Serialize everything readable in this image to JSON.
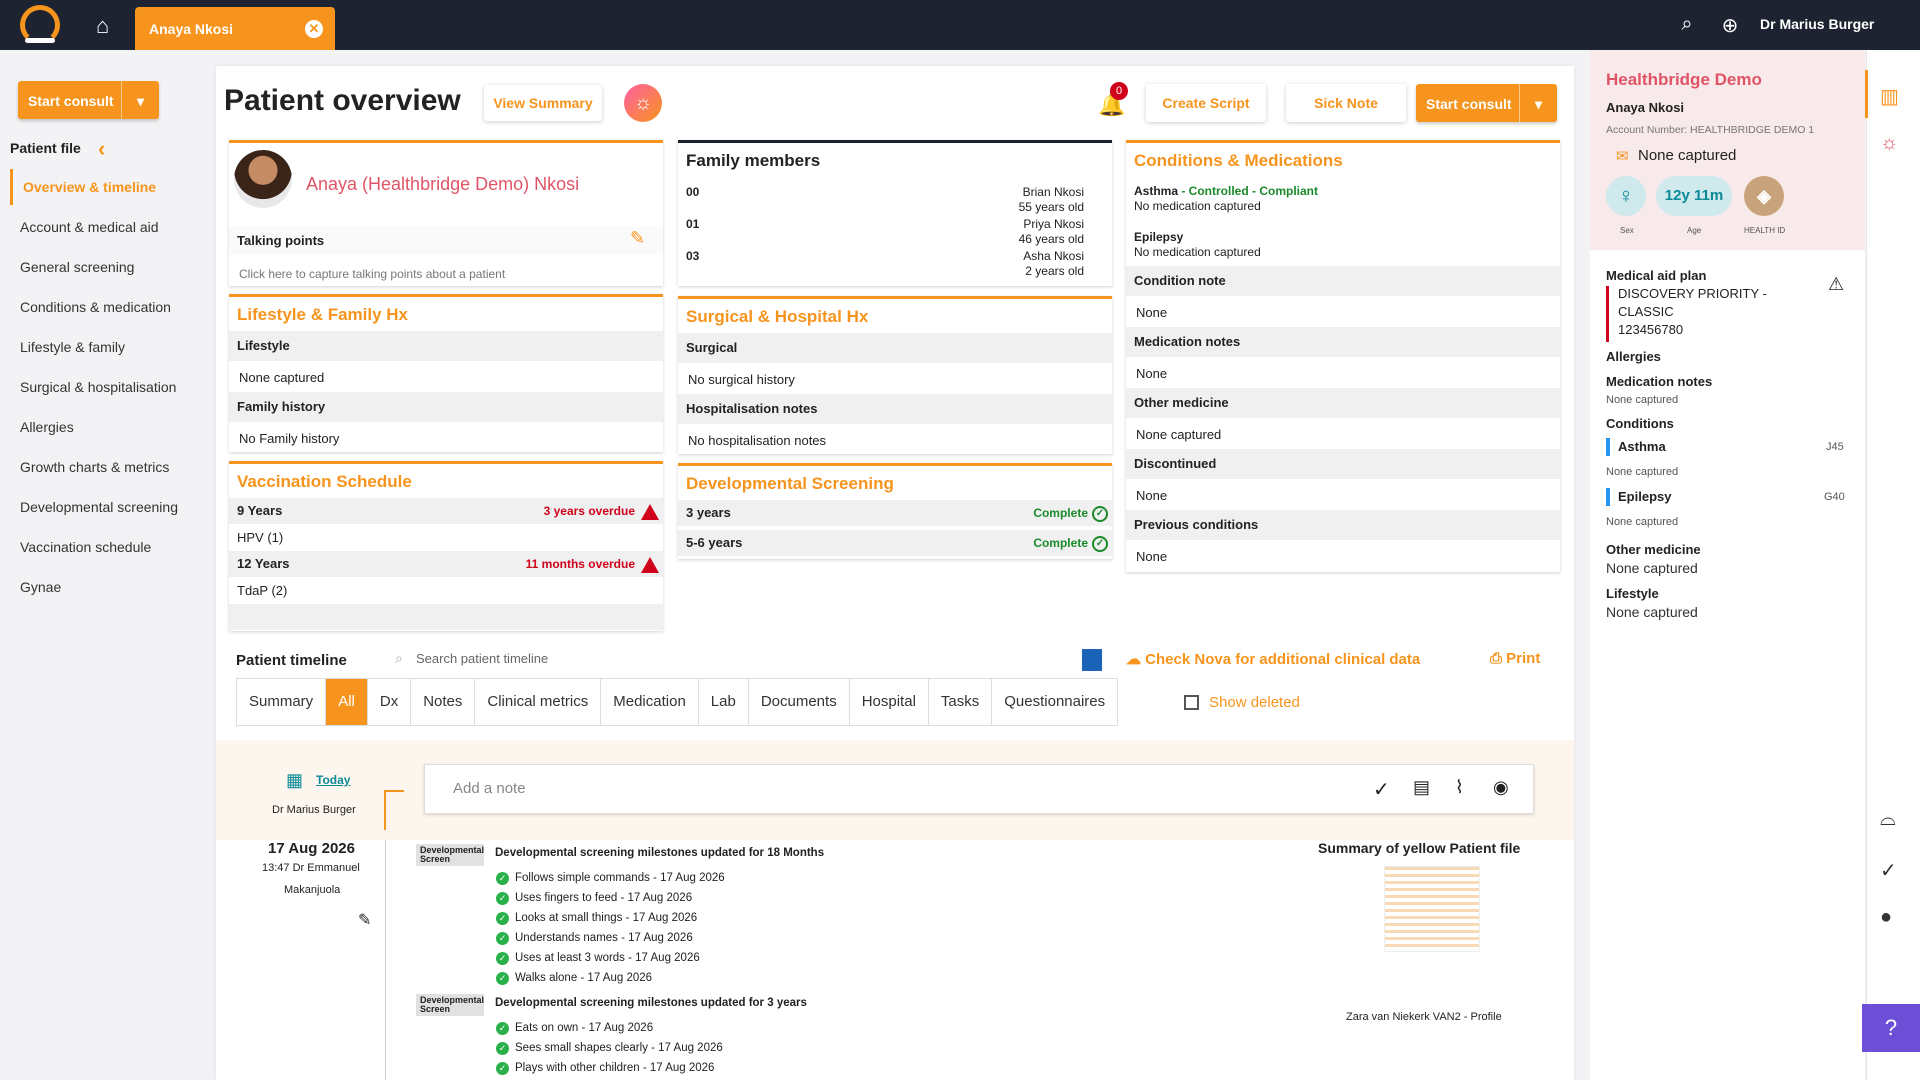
{
  "topbar": {
    "tab_name": "Anaya Nkosi",
    "user": "Dr Marius Burger"
  },
  "sidebar": {
    "start_consult": "Start consult",
    "title": "Patient file",
    "items": [
      "Overview & timeline",
      "Account & medical aid",
      "General screening",
      "Conditions & medication",
      "Lifestyle & family",
      "Surgical & hospitalisation",
      "Allergies",
      "Growth charts & metrics",
      "Developmental screening",
      "Vaccination schedule",
      "Gynae"
    ]
  },
  "header": {
    "title": "Patient overview",
    "view_summary": "View Summary",
    "notif_count": "0",
    "create_script": "Create Script",
    "sick_note": "Sick Note",
    "start_consult": "Start consult"
  },
  "patient": {
    "name": "Anaya (Healthbridge Demo) Nkosi",
    "talking_points": "Talking points",
    "talking_placeholder": "Click here to capture talking points about a patient"
  },
  "family": {
    "title": "Family members",
    "members": [
      {
        "code": "00",
        "name": "Brian Nkosi",
        "age": "55 years old"
      },
      {
        "code": "01",
        "name": "Priya Nkosi",
        "age": "46 years old"
      },
      {
        "code": "03",
        "name": "Asha Nkosi",
        "age": "2 years old"
      }
    ]
  },
  "conditions": {
    "title": "Conditions & Medications",
    "c1_name": "Asthma",
    "c1_status": " - Controlled - Compliant",
    "c1_med": "No medication captured",
    "c2_name": "Epilepsy",
    "c2_med": "No medication captured",
    "rows": [
      {
        "h": "Condition note",
        "v": "None"
      },
      {
        "h": "Medication notes",
        "v": "None"
      },
      {
        "h": "Other medicine",
        "v": "None captured"
      },
      {
        "h": "Discontinued",
        "v": "None"
      },
      {
        "h": "Previous conditions",
        "v": "None"
      }
    ]
  },
  "lifestyle": {
    "title": "Lifestyle & Family Hx",
    "h1": "Lifestyle",
    "v1": "None captured",
    "h2": "Family history",
    "v2": "No Family history"
  },
  "surgical": {
    "title": "Surgical & Hospital Hx",
    "h1": "Surgical",
    "v1": "No surgical history",
    "h2": "Hospitalisation notes",
    "v2": "No hospitalisation notes"
  },
  "vaccination": {
    "title": "Vaccination Schedule",
    "r1": "9 Years",
    "r1_status": "3 years overdue",
    "r1_item": "HPV (1)",
    "r2": "12 Years",
    "r2_status": "11 months overdue",
    "r2_item": "TdaP (2)"
  },
  "devscreen": {
    "title": "Developmental Screening",
    "r1": "3 years",
    "r1_status": "Complete",
    "r2": "5-6 years",
    "r2_status": "Complete"
  },
  "timeline": {
    "title": "Patient timeline",
    "search_placeholder": "Search patient timeline",
    "nova": "Check Nova for additional clinical data",
    "print": "Print",
    "tabs": [
      "Summary",
      "All",
      "Dx",
      "Notes",
      "Clinical metrics",
      "Medication",
      "Lab",
      "Documents",
      "Hospital",
      "Tasks",
      "Questionnaires"
    ],
    "show_deleted": "Show deleted",
    "today": "Today",
    "today_user": "Dr Marius Burger",
    "note_placeholder": "Add a note",
    "entry_date": "17 Aug 2026",
    "entry_time": "13:47 Dr Emmanuel",
    "entry_author": "Makanjuola",
    "badge": "Developmental Screen",
    "e1_title": "Developmental screening milestones updated for 18 Months",
    "e1_items": [
      "Follows simple commands  - 17 Aug 2026",
      "Uses fingers to feed  - 17 Aug 2026",
      "Looks at small things  - 17 Aug 2026",
      "Understands names  - 17 Aug 2026",
      "Uses at least 3 words  - 17 Aug 2026",
      "Walks alone  - 17 Aug 2026"
    ],
    "e2_title": "Developmental screening milestones updated for 3 years",
    "e2_items": [
      "Eats on own  - 17 Aug 2026",
      "Sees small shapes clearly  - 17 Aug 2026",
      "Plays with other children  - 17 Aug 2026"
    ],
    "summary_title": "Summary of yellow Patient file",
    "summary_profile": "Zara van Niekerk VAN2 - Profile"
  },
  "rpanel": {
    "org": "Healthbridge Demo",
    "name": "Anaya Nkosi",
    "account": "Account Number: HEALTHBRIDGE DEMO 1",
    "email": "None captured",
    "age": "12y 11m",
    "sex_lbl": "Sex",
    "age_lbl": "Age",
    "hid_lbl": "HEALTH ID",
    "med_aid_h": "Medical aid plan",
    "med_aid_1": "DISCOVERY PRIORITY -",
    "med_aid_2": "CLASSIC",
    "med_aid_3": "123456780",
    "allergies": "Allergies",
    "med_notes": "Medication notes",
    "med_notes_v": "None captured",
    "conditions": "Conditions",
    "c1": "Asthma",
    "c1_code": "J45",
    "c1_v": "None captured",
    "c2": "Epilepsy",
    "c2_code": "G40",
    "c2_v": "None captured",
    "other_h": "Other medicine",
    "other_v": "None captured",
    "life_h": "Lifestyle",
    "life_v": "None captured"
  }
}
